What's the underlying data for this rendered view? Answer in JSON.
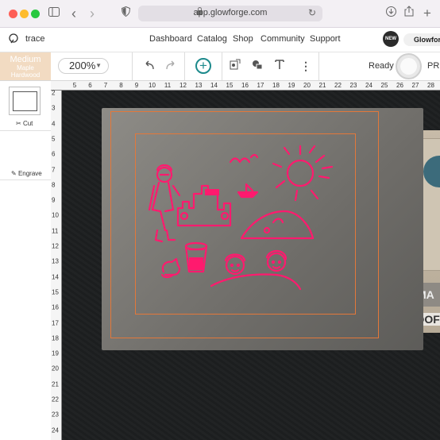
{
  "browser": {
    "url": "app.glowforge.com",
    "icons": [
      "sidebar-icon",
      "back-icon",
      "forward-icon",
      "shield-icon",
      "lock-icon",
      "reload-icon",
      "download-icon",
      "share-icon",
      "new-tab-icon"
    ]
  },
  "header": {
    "logo_icon": "glowforge-logo-icon",
    "doc_title": "trace",
    "nav": [
      "Dashboard",
      "Catalog",
      "Shop",
      "Community",
      "Support"
    ],
    "new_badge": "NEW",
    "user": "Glowforge"
  },
  "toolbar": {
    "material": {
      "thickness": "Medium",
      "name_line1": "Maple",
      "name_line2": "Hardwood"
    },
    "zoom": "200%",
    "status": "Ready",
    "print_label": "PRI",
    "icons": [
      "undo-icon",
      "redo-icon",
      "add-icon",
      "trace-icon",
      "shapes-icon",
      "text-icon",
      "more-icon"
    ]
  },
  "left_panel": {
    "steps": [
      {
        "label": "Cut",
        "icon": "scissors-icon"
      },
      {
        "label": "Engrave",
        "icon": "pencil-icon"
      }
    ]
  },
  "rulers": {
    "top": [
      "5",
      "6",
      "7",
      "8",
      "9",
      "10",
      "11",
      "12",
      "13",
      "14",
      "15",
      "16",
      "17",
      "18",
      "19",
      "20",
      "21",
      "22",
      "23",
      "24",
      "25",
      "26",
      "27",
      "28"
    ],
    "left": [
      "2",
      "3",
      "4",
      "5",
      "6",
      "7",
      "8",
      "9",
      "10",
      "11",
      "12",
      "13",
      "14",
      "15",
      "16",
      "17",
      "18",
      "19",
      "20",
      "21",
      "22",
      "23",
      "24"
    ]
  },
  "bed": {
    "material_text_1": "MA",
    "material_text_2": "PROOF",
    "art_color": "#ff1a6e",
    "outline_color": "#e3783a"
  }
}
